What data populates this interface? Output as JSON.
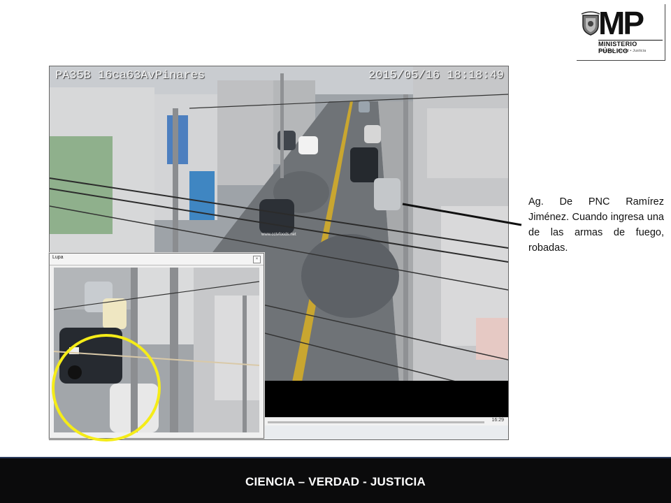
{
  "logo": {
    "letters": "MP",
    "institution": "MINISTERIO PÚBLICO",
    "motto": "Ciencia • Verdad • Justicia"
  },
  "cctv": {
    "osd_camera": "PA35B 16ca63AvPinares",
    "osd_datetime": "2015/05/16 18:18:49",
    "watermark": "www.cctvfoods.net",
    "playback_time": "16:29"
  },
  "lupa": {
    "title": "Lupa",
    "close_label": "×"
  },
  "annotation": {
    "text": "Ag. De PNC Ramírez Jiménez. Cuando ingresa una de las armas de fuego, robadas."
  },
  "footer": {
    "text": "CIENCIA – VERDAD - JUSTICIA"
  },
  "colors": {
    "highlight_ring": "#f5ec18",
    "footer_bg": "#0b0b0c",
    "pointer_line": "#111111"
  }
}
